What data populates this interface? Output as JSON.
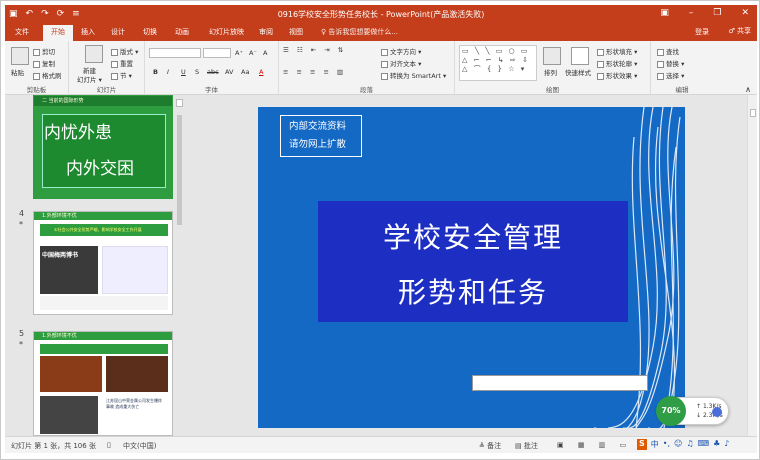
{
  "titlebar": {
    "title": "0916学校安全形势任务校长 - PowerPoint(产品激活失败)",
    "qat": [
      "▣",
      "↶",
      "↷",
      "⟳",
      "≡"
    ],
    "controls": [
      "▣",
      "–",
      "❐",
      "✕"
    ]
  },
  "tabs": [
    "文件",
    "开始",
    "插入",
    "设计",
    "切换",
    "动画",
    "幻灯片放映",
    "审阅",
    "视图"
  ],
  "active_tab": "开始",
  "tell_me": "♀ 告诉我您想要做什么...",
  "login_label": "登录",
  "share_label": "♂ 共享",
  "ribbon": {
    "clipboard": {
      "paste": "粘贴",
      "cut": "剪切",
      "copy": "复制",
      "format_painter": "格式刷",
      "label": "剪贴板"
    },
    "slides": {
      "new_slide": "新建",
      "new_slide2": "幻灯片 ▾",
      "layout": "版式 ▾",
      "reset": "重置",
      "section": "节 ▾",
      "label": "幻灯片"
    },
    "font": {
      "label": "字体",
      "bold": "B",
      "italic": "I",
      "underline": "U",
      "shadow": "S",
      "strike": "abc",
      "spacing": "AV",
      "case": "Aa",
      "grow": "A⁺",
      "shrink": "A⁻",
      "clear": "A",
      "color": "A"
    },
    "paragraph": {
      "label": "段落",
      "text_direction": "文字方向 ▾",
      "align_text": "对齐文本 ▾",
      "smartart": "转换为 SmartArt ▾"
    },
    "drawing": {
      "label": "绘图",
      "arrange": "排列",
      "quick_styles": "快速样式",
      "fill": "形状填充 ▾",
      "outline": "形状轮廓 ▾",
      "effects": "形状效果 ▾",
      "shapes": "▭ ╲ ╲ ▭ ○ ▭\n△ ⌐ ⌐ ↳ ⇨ ⇩\n△ ⌒ { } ☆ ▾"
    },
    "editing": {
      "label": "编辑",
      "find": "查找",
      "replace": "替换 ▾",
      "select": "选择 ▾"
    }
  },
  "thumbnails": [
    {
      "number": "",
      "title": "二 当前的国际形势",
      "lines": [
        "内忧外患",
        "内外交困"
      ]
    },
    {
      "number": "4",
      "title": "1.外部环境不优",
      "subtitle": "①社会公共安全形势严峻，影响学校安全工作开展",
      "photo_text": "中国梅两博书"
    },
    {
      "number": "5",
      "title": "1.外部环境不优",
      "caption": "江苏昆山中荣金属公司发生爆炸事故 造成重大伤亡"
    }
  ],
  "slide": {
    "notice_lines": [
      "内部交流资料",
      "请勿网上扩散"
    ],
    "title_line1": "学校安全管理",
    "title_line2": "形势和任务"
  },
  "network_widget": {
    "percent": "70%",
    "up": "1.3K/s",
    "down": "2.3M/s"
  },
  "statusbar": {
    "slide_info": "幻灯片 第 1 张，共 106 张",
    "language": "中文(中国)",
    "notes": "≜ 备注",
    "comments": "▤ 批注",
    "ime": [
      "中",
      "•,",
      "☺",
      "♫",
      "⌨",
      "♣",
      "♪"
    ]
  },
  "colors": {
    "accent": "#c43e1c",
    "slide_bg": "#1469c4",
    "title_box": "#1d2ec2",
    "thumb_green": "#2e9d3f"
  }
}
